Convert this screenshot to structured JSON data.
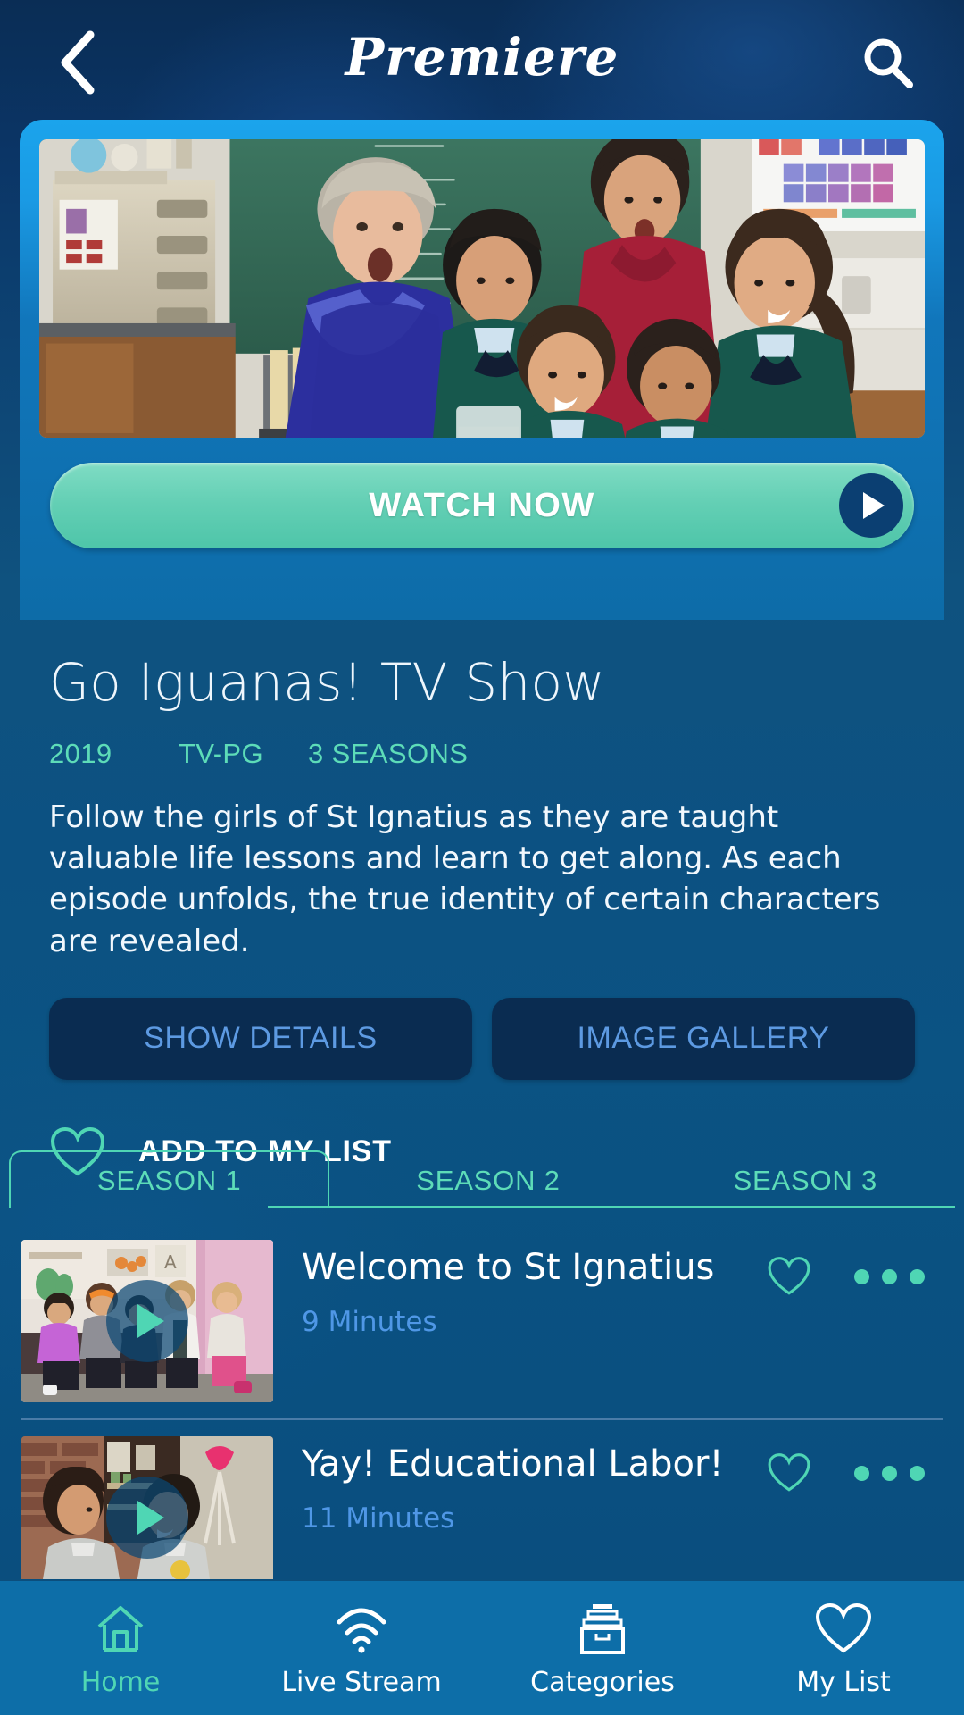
{
  "header": {
    "back_icon": "chevron-left-icon",
    "title": "Premiere",
    "search_icon": "search-icon"
  },
  "hero": {
    "image_alt": "classroom-science-scene",
    "watch_label": "WATCH NOW",
    "play_icon": "play-icon"
  },
  "show": {
    "title": "Go Iguanas! TV Show",
    "year": "2019",
    "rating": "TV-PG",
    "seasons": "3 SEASONS",
    "synopsis": "Follow the girls of St Ignatius as they are taught valuable life lessons and learn to get along. As each episode unfolds, the true identity of certain characters are revealed.",
    "show_details_label": "SHOW DETAILS",
    "image_gallery_label": "IMAGE GALLERY",
    "add_list_label": "ADD TO MY LIST",
    "heart_icon": "heart-outline-icon"
  },
  "seasons": {
    "tabs": [
      {
        "label": "SEASON 1",
        "active": true
      },
      {
        "label": "SEASON 2",
        "active": false
      },
      {
        "label": "SEASON 3",
        "active": false
      }
    ]
  },
  "episodes": [
    {
      "title": "Welcome to St Ignatius",
      "duration": "9 Minutes",
      "thumb_alt": "girls-on-couch-kitchen",
      "play_icon": "play-icon",
      "heart_icon": "heart-outline-icon",
      "more_icon": "more-horizontal-icon"
    },
    {
      "title": "Yay! Educational Labor!",
      "duration": "11 Minutes",
      "thumb_alt": "two-students-classroom",
      "play_icon": "play-icon",
      "heart_icon": "heart-outline-icon",
      "more_icon": "more-horizontal-icon"
    }
  ],
  "bottom_nav": [
    {
      "label": "Home",
      "icon": "home-icon",
      "active": true
    },
    {
      "label": "Live Stream",
      "icon": "wifi-icon",
      "active": false
    },
    {
      "label": "Categories",
      "icon": "file-box-icon",
      "active": false
    },
    {
      "label": "My List",
      "icon": "heart-outline-icon",
      "active": false
    }
  ],
  "colors": {
    "accent_mint": "#4fd6b4",
    "accent_blue": "#1ba4ec",
    "link_blue": "#5d9ae2",
    "nav_bar": "#0d6ea8",
    "dark_pill": "#0a2c51"
  }
}
